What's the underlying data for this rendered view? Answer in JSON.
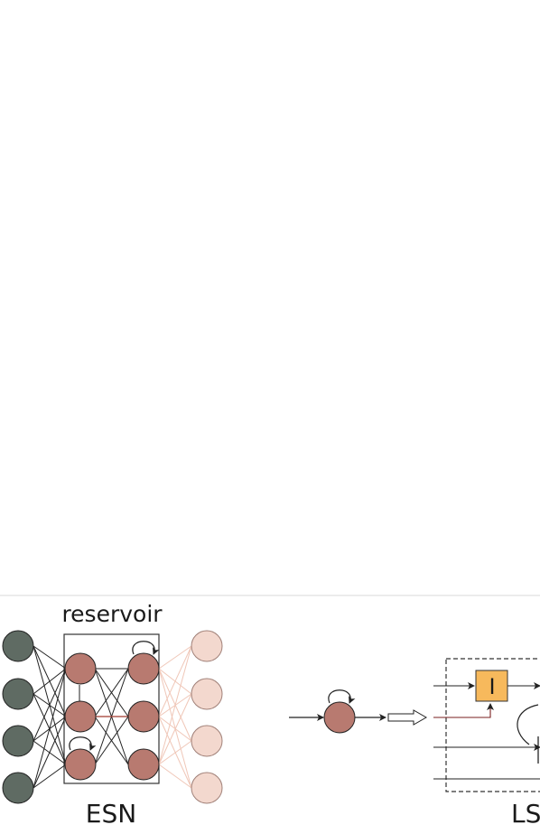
{
  "labels": {
    "reservoir": "reservoir",
    "esn": "ESN",
    "lstm_partial": "LS",
    "gate": "I"
  },
  "colors": {
    "input_node": "#5f6b63",
    "reservoir_node": "#b87a70",
    "output_node": "#f3d8ce",
    "gate_fill": "#f7b95c",
    "separator": "#d9d9d9"
  },
  "icons": {
    "self_loop": "self-loop-arrow-icon",
    "transform_arrow": "hollow-right-arrow-icon"
  }
}
